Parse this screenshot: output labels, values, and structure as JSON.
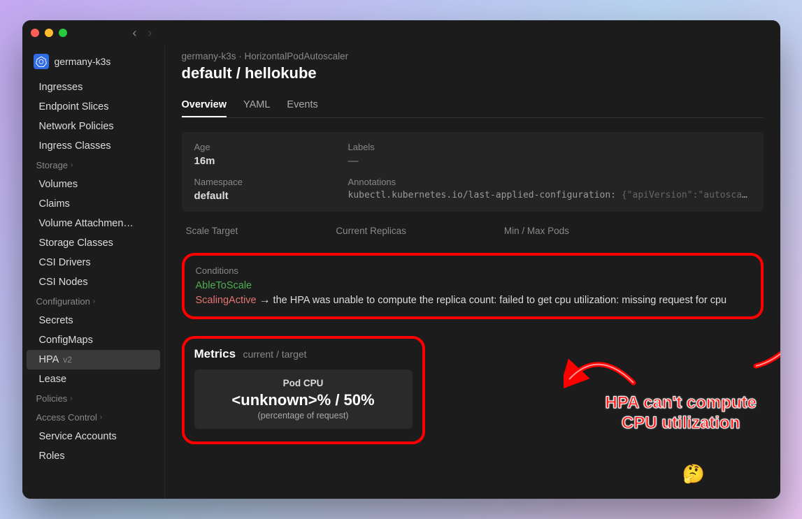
{
  "cluster": {
    "name": "germany-k3s"
  },
  "breadcrumb": "germany-k3s · HorizontalPodAutoscaler",
  "page_title": "default / hellokube",
  "tabs": {
    "overview": "Overview",
    "yaml": "YAML",
    "events": "Events"
  },
  "info": {
    "age_label": "Age",
    "age_value": "16m",
    "labels_label": "Labels",
    "labels_value": "—",
    "ns_label": "Namespace",
    "ns_value": "default",
    "anno_label": "Annotations",
    "anno_key": "kubectl.kubernetes.io/last-applied-configuration:",
    "anno_val": "{\"apiVersion\":\"autoscaling/…"
  },
  "stats": {
    "scale_target": "Scale Target",
    "current_replicas": "Current Replicas",
    "minmax": "Min / Max Pods"
  },
  "conditions": {
    "label": "Conditions",
    "ok": "AbleToScale",
    "err": "ScalingActive",
    "msg": "the HPA was unable to compute the replica count: failed to get cpu utilization: missing request for cpu"
  },
  "metrics": {
    "title": "Metrics",
    "subtitle": "current / target",
    "card_name": "Pod CPU",
    "card_value": "<unknown>% / 50%",
    "card_sub": "(percentage of request)"
  },
  "sidebar": {
    "items_top": [
      "Ingresses",
      "Endpoint Slices",
      "Network Policies",
      "Ingress Classes"
    ],
    "section_storage": "Storage",
    "items_storage": [
      "Volumes",
      "Claims",
      "Volume Attachmen…",
      "Storage Classes",
      "CSI Drivers",
      "CSI Nodes"
    ],
    "section_config": "Configuration",
    "items_config": [
      "Secrets",
      "ConfigMaps"
    ],
    "hpa_label": "HPA",
    "hpa_ver": "v2",
    "lease": "Lease",
    "section_policies": "Policies",
    "section_access": "Access Control",
    "items_access": [
      "Service Accounts",
      "Roles"
    ]
  },
  "annotation": {
    "line1": "HPA can't compute",
    "line2": "CPU utilization",
    "emoji": "🤔"
  }
}
